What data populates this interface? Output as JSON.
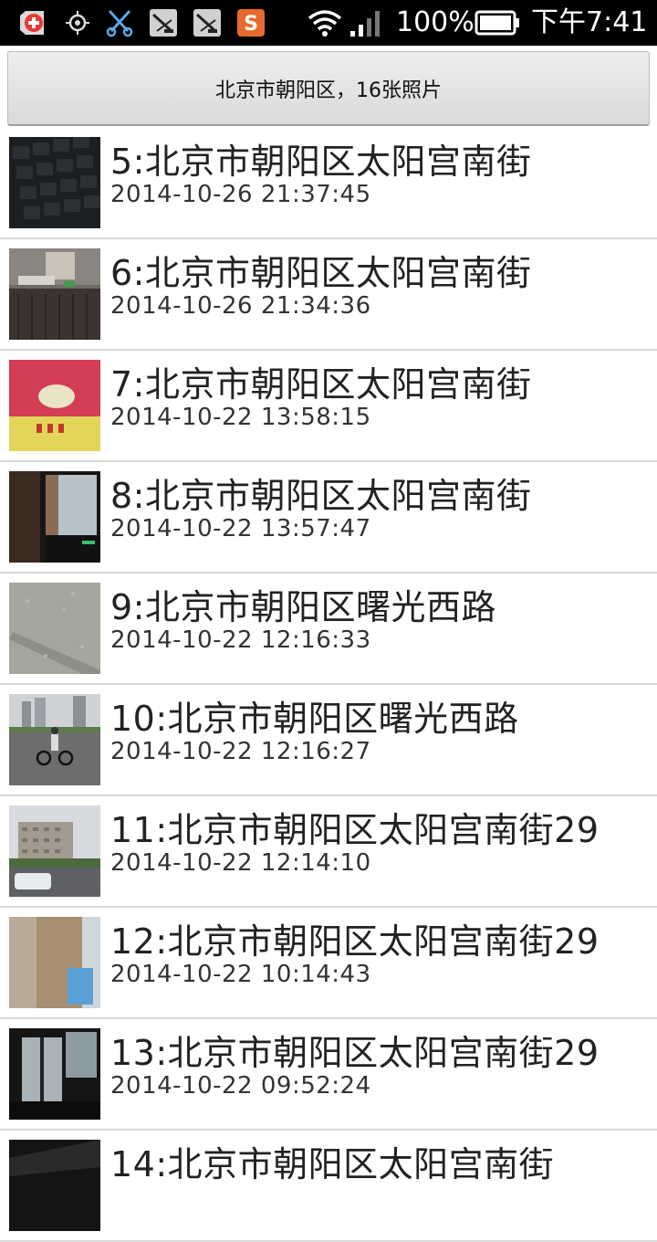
{
  "status_bar": {
    "battery_percent": "100%",
    "time": "下午7:41",
    "icons": [
      "add-notification-icon",
      "location-icon",
      "scissors-icon",
      "app-icon-1",
      "app-icon-2",
      "sogou-input-icon",
      "wifi-icon",
      "signal-icon",
      "battery-icon"
    ]
  },
  "header": {
    "label": "北京市朝阳区，16张照片"
  },
  "photos": [
    {
      "title": "5:北京市朝阳区太阳宫南街",
      "date": "2014-10-26 21:37:45",
      "thumb": "keyboard-photo"
    },
    {
      "title": "6:北京市朝阳区太阳宫南街",
      "date": "2014-10-26 21:34:36",
      "thumb": "desk-photo"
    },
    {
      "title": "7:北京市朝阳区太阳宫南街",
      "date": "2014-10-22 13:58:15",
      "thumb": "package-photo"
    },
    {
      "title": "8:北京市朝阳区太阳宫南街",
      "date": "2014-10-22 13:57:47",
      "thumb": "window-photo"
    },
    {
      "title": "9:北京市朝阳区曙光西路",
      "date": "2014-10-22 12:16:33",
      "thumb": "pavement-photo"
    },
    {
      "title": "10:北京市朝阳区曙光西路",
      "date": "2014-10-22 12:16:27",
      "thumb": "street-cyclist-photo"
    },
    {
      "title": "11:北京市朝阳区太阳宫南街29",
      "date": "2014-10-22 12:14:10",
      "thumb": "building-photo"
    },
    {
      "title": "12:北京市朝阳区太阳宫南街29",
      "date": "2014-10-22 10:14:43",
      "thumb": "curtain-photo"
    },
    {
      "title": "13:北京市朝阳区太阳宫南街29",
      "date": "2014-10-22 09:52:24",
      "thumb": "room-window-photo"
    },
    {
      "title": "14:北京市朝阳区太阳宫南街",
      "date": "",
      "thumb": "dark-photo"
    }
  ]
}
